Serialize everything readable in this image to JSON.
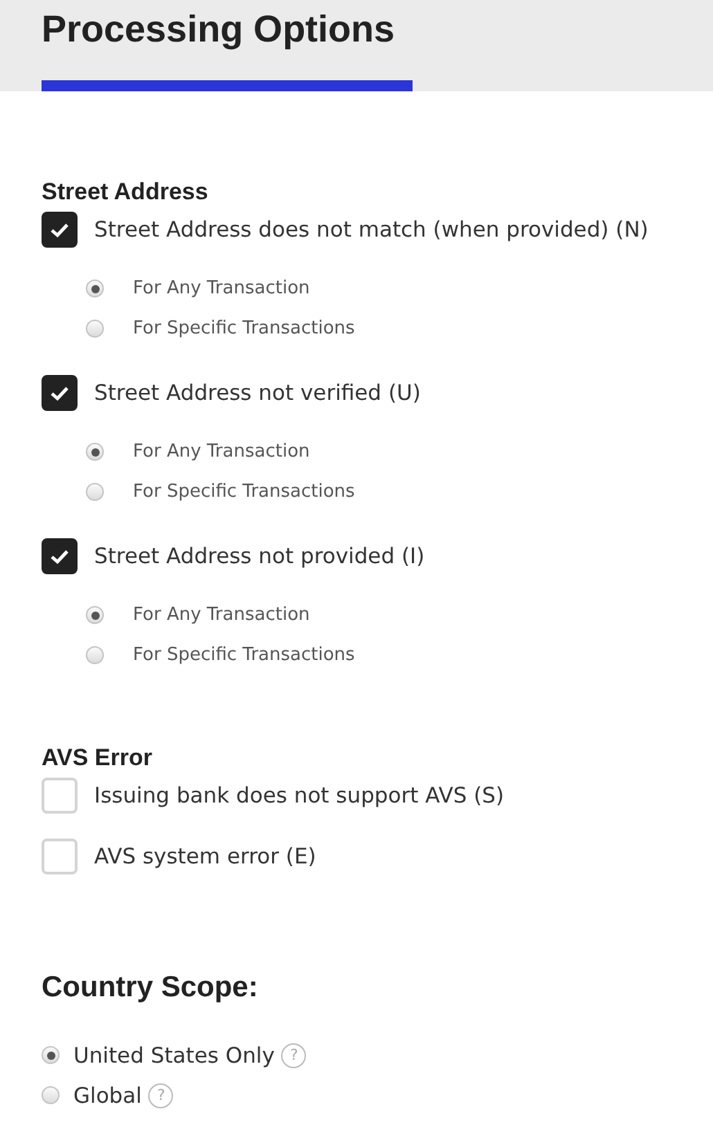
{
  "header": {
    "title": "Processing Options"
  },
  "sections": [
    {
      "heading": "Street Address",
      "items": [
        {
          "label": "Street Address does not match (when provided) (N)",
          "checked": true,
          "options": [
            {
              "label": "For Any Transaction",
              "selected": true
            },
            {
              "label": "For Specific Transactions",
              "selected": false
            }
          ]
        },
        {
          "label": "Street Address not verified (U)",
          "checked": true,
          "options": [
            {
              "label": "For Any Transaction",
              "selected": true
            },
            {
              "label": "For Specific Transactions",
              "selected": false
            }
          ]
        },
        {
          "label": "Street Address not provided (I)",
          "checked": true,
          "options": [
            {
              "label": "For Any Transaction",
              "selected": true
            },
            {
              "label": "For Specific Transactions",
              "selected": false
            }
          ]
        }
      ]
    },
    {
      "heading": "AVS Error",
      "items": [
        {
          "label": "Issuing bank does not support AVS (S)",
          "checked": false
        },
        {
          "label": "AVS system error (E)",
          "checked": false
        }
      ]
    }
  ],
  "country_scope": {
    "heading": "Country Scope:",
    "options": [
      {
        "label": "United States Only",
        "selected": true,
        "help": "?"
      },
      {
        "label": "Global",
        "selected": false,
        "help": "?"
      }
    ]
  }
}
